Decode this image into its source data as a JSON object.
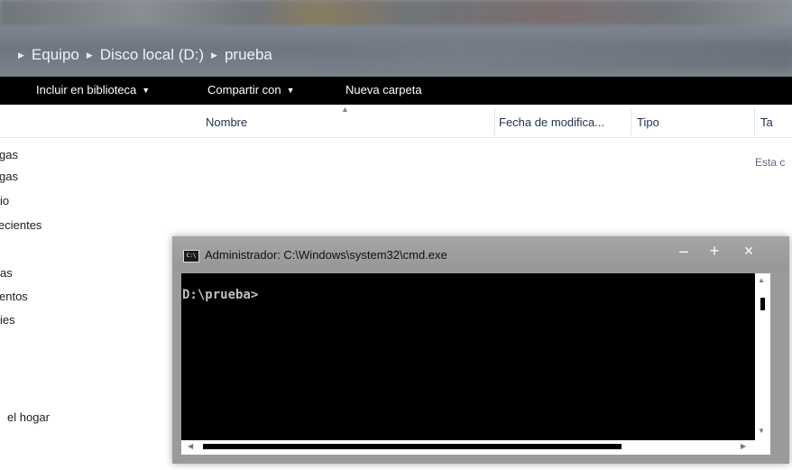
{
  "explorer": {
    "breadcrumb": [
      "Equipo",
      "Disco local (D:)",
      "prueba"
    ],
    "commands": {
      "include_in_library": "Incluir en biblioteca",
      "share_with": "Compartir con",
      "new_folder": "Nueva carpeta"
    },
    "columns": {
      "name": "Nombre",
      "date_modified": "Fecha de modifica...",
      "type": "Tipo",
      "size": "Ta"
    },
    "empty_message": "Esta c",
    "nav_items": [
      "gas",
      "gas",
      "io",
      "ecientes",
      "as",
      "entos",
      "ies",
      "el hogar"
    ]
  },
  "cmd": {
    "title": "Administrador: C:\\Windows\\system32\\cmd.exe",
    "icon_label": "C:\\",
    "prompt": "D:\\prueba>",
    "buttons": {
      "minimize": "–",
      "maximize": "+",
      "close": "×"
    }
  },
  "colors": {
    "console_bg": "#000000",
    "console_text": "#c0c0c0",
    "command_bar_bg": "#000000",
    "title_bar": "#9a9a9a"
  }
}
